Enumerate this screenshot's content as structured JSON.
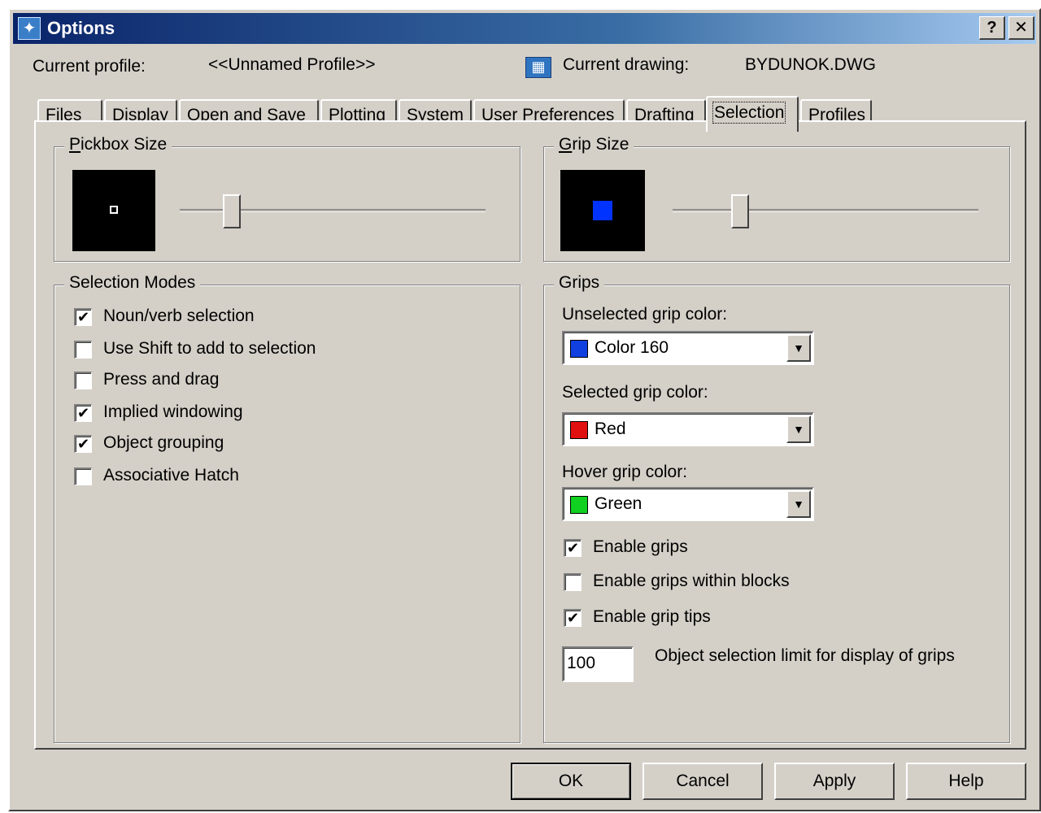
{
  "window": {
    "title": "Options",
    "help_label": "?",
    "close_label": "✕"
  },
  "profile": {
    "label": "Current profile:",
    "value": "<<Unnamed Profile>>",
    "drawing_label": "Current drawing:",
    "drawing_value": "BYDUNOK.DWG"
  },
  "tabs": [
    {
      "label": "Files"
    },
    {
      "label": "Display"
    },
    {
      "label": "Open and Save"
    },
    {
      "label": "Plotting"
    },
    {
      "label": "System"
    },
    {
      "label": "User Preferences"
    },
    {
      "label": "Drafting"
    },
    {
      "label": "Selection",
      "active": true
    },
    {
      "label": "Profiles"
    }
  ],
  "pickbox": {
    "title": "Pickbox Size",
    "slider_level": 0.17,
    "preview_color": "#000000"
  },
  "gripsize": {
    "title": "Grip Size",
    "slider_level": 0.22,
    "preview_color": "#0033ff"
  },
  "selection_modes": {
    "title": "Selection Modes",
    "items": [
      {
        "label": "Noun/verb selection",
        "checked": true
      },
      {
        "label": "Use Shift to add to selection",
        "checked": false
      },
      {
        "label": "Press and drag",
        "checked": false
      },
      {
        "label": "Implied windowing",
        "checked": true
      },
      {
        "label": "Object grouping",
        "checked": true
      },
      {
        "label": "Associative Hatch",
        "checked": false
      }
    ]
  },
  "grips": {
    "title": "Grips",
    "unselected_label": "Unselected grip color:",
    "unselected_value": "Color 160",
    "unselected_color": "#1040e0",
    "selected_label": "Selected grip color:",
    "selected_value": "Red",
    "selected_color": "#e01010",
    "hover_label": "Hover grip color:",
    "hover_value": "Green",
    "hover_color": "#10d020",
    "checks": [
      {
        "label": "Enable grips",
        "checked": true
      },
      {
        "label": "Enable grips within blocks",
        "checked": false
      },
      {
        "label": "Enable grip tips",
        "checked": true
      }
    ],
    "limit_value": "100",
    "limit_label": "Object selection limit for display of grips"
  },
  "buttons": {
    "ok": "OK",
    "cancel": "Cancel",
    "apply": "Apply",
    "help": "Help"
  },
  "check_glyph": "✔"
}
